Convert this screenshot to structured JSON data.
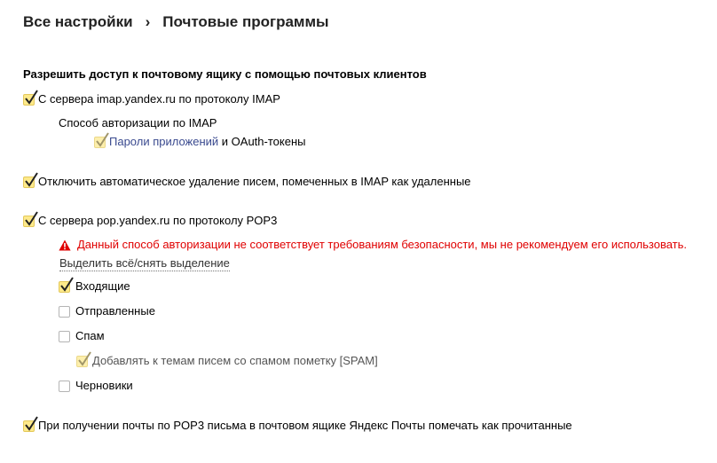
{
  "breadcrumb": {
    "root": "Все настройки",
    "separator": "›",
    "current": "Почтовые программы"
  },
  "section_heading": "Разрешить доступ к почтовому ящику с помощью почтовых клиентов",
  "imap": {
    "label": "С сервера imap.yandex.ru по протоколу IMAP",
    "checked": true,
    "auth_caption": "Способ авторизации по IMAP",
    "app_passwords_link": "Пароли приложений",
    "app_passwords_suffix": " и OAuth-токены",
    "app_passwords_checked": true
  },
  "imap_disable_autodelete": {
    "label": "Отключить автоматическое удаление писем, помеченных в IMAP как удаленные",
    "checked": true
  },
  "pop3": {
    "label": "С сервера pop.yandex.ru по протоколу POP3",
    "checked": true,
    "warning": "Данный способ авторизации не соответствует требованиям безопасности, мы не рекомендуем его использовать.",
    "select_all": "Выделить всё/снять выделение",
    "folders": [
      {
        "label": "Входящие",
        "checked": true
      },
      {
        "label": "Отправленные",
        "checked": false
      },
      {
        "label": "Спам",
        "checked": false
      },
      {
        "label": "Черновики",
        "checked": false
      }
    ],
    "spam_tag": {
      "label": "Добавлять к темам писем со спамом пометку [SPAM]",
      "checked": true
    }
  },
  "pop3_mark_read": {
    "label": "При получении почты по POP3 письма в почтовом ящике Яндекс Почты помечать как прочитанные",
    "checked": true
  },
  "colors": {
    "checkbox_fill": "#fde98a",
    "checkmark": "#222222",
    "warning": "#e00000",
    "link": "#3a4a8f"
  }
}
